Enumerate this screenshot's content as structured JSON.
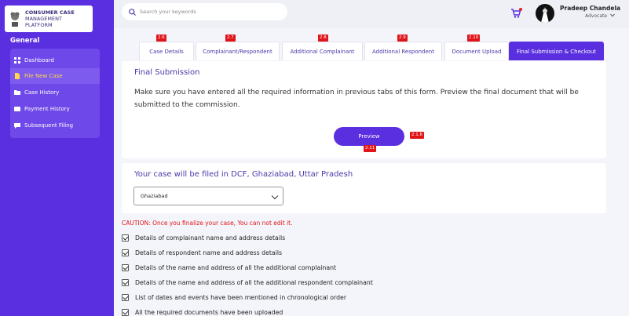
{
  "app": {
    "logo_line1": "CONSUMER CASE",
    "logo_line2": "MANAGEMENT",
    "logo_line3": "PLATFORM"
  },
  "sidebar": {
    "section_label": "General",
    "items": [
      {
        "label": "Dashboard",
        "icon": "grid-icon",
        "active": false
      },
      {
        "label": "File New Case",
        "icon": "file-icon",
        "active": true
      },
      {
        "label": "Case History",
        "icon": "folder-icon",
        "active": false
      },
      {
        "label": "Payment History",
        "icon": "wallet-icon",
        "active": false
      },
      {
        "label": "Subsequent Filing",
        "icon": "chat-icon",
        "active": false
      }
    ]
  },
  "header": {
    "search_placeholder": "Search your keywords",
    "user_name": "Pradeep Chandela",
    "user_role": "Advocate"
  },
  "tabs": [
    {
      "label": "Case Details",
      "tag": "2.6"
    },
    {
      "label": "Complainant/Respondent",
      "tag": "2.7"
    },
    {
      "label": "Additional Complainant",
      "tag": "2.8"
    },
    {
      "label": "Additional Respondent",
      "tag": "2.9"
    },
    {
      "label": "Document Upload",
      "tag": "2.10"
    },
    {
      "label": "Final Submission & Checkout",
      "tag": ""
    }
  ],
  "final_submission": {
    "title": "Final Submission",
    "body": "Make sure you have entered all the required information in previous tabs of this form. Preview the final document that will be submitted to the commission.",
    "preview_label": "Preview",
    "preview_tag": "2.11",
    "section_tag": "2.1.6"
  },
  "filing": {
    "title": "Your case will be filed in DCF, Ghaziabad, Uttar Pradesh",
    "selected": "Ghaziabad"
  },
  "caution": "CAUTION: Once you finalize your case, You can not edit it.",
  "checklist": [
    "Details of complainant name and address details",
    "Details of respondent name and address details",
    "Details of the name and address of all the additional complainant",
    "Details of the name and address of all the additional respondent complainant",
    "List of dates and events have been mentioned in chronological order",
    "All the required documents have been uploaded"
  ],
  "colors": {
    "primary": "#5a2fe0",
    "active_nav_text": "#ffd84a",
    "tag_red": "#e0151a"
  }
}
